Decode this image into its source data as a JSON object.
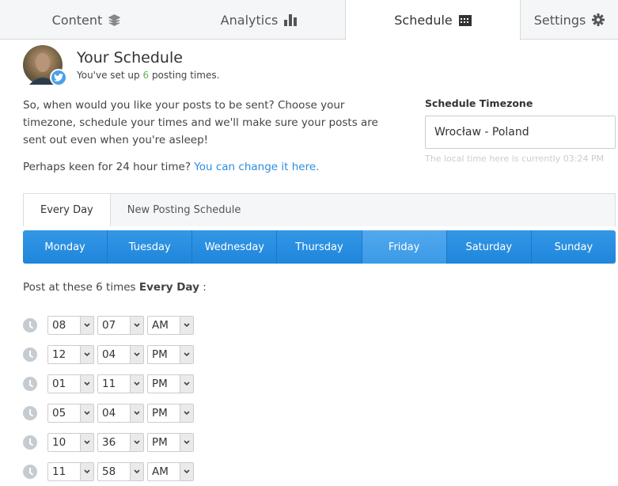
{
  "topnav": {
    "tabs": [
      {
        "label": "Content",
        "icon": "layers-icon"
      },
      {
        "label": "Analytics",
        "icon": "bar-chart-icon"
      },
      {
        "label": "Schedule",
        "icon": "calendar-icon",
        "active": true
      },
      {
        "label": "Settings",
        "icon": "gear-icon"
      }
    ]
  },
  "header": {
    "title": "Your Schedule",
    "sub_prefix": "You've set up ",
    "count": "6",
    "sub_suffix": " posting times."
  },
  "intro": {
    "text": "So, when would you like your posts to be sent? Choose your timezone, schedule your times and we'll make sure your posts are sent out even when you're asleep!",
    "prompt": "Perhaps keen for 24 hour time? ",
    "link": "You can change it here."
  },
  "timezone": {
    "label": "Schedule Timezone",
    "value": "Wrocław - Poland",
    "hint": "The local time here is currently 03:24 PM"
  },
  "schedule_tabs": [
    "Every Day",
    "New Posting Schedule"
  ],
  "days": [
    "Monday",
    "Tuesday",
    "Wednesday",
    "Thursday",
    "Friday",
    "Saturday",
    "Sunday"
  ],
  "highlighted_day": "Friday",
  "post_label": {
    "prefix": "Post at these 6 times ",
    "bold": "Every Day",
    "suffix": " :"
  },
  "times": [
    {
      "h": "08",
      "m": "07",
      "p": "AM"
    },
    {
      "h": "12",
      "m": "04",
      "p": "PM"
    },
    {
      "h": "01",
      "m": "11",
      "p": "PM"
    },
    {
      "h": "05",
      "m": "04",
      "p": "PM"
    },
    {
      "h": "10",
      "m": "36",
      "p": "PM"
    },
    {
      "h": "11",
      "m": "58",
      "p": "AM"
    }
  ],
  "colors": {
    "accent": "#2b8de0",
    "count": "#5cb85c"
  }
}
